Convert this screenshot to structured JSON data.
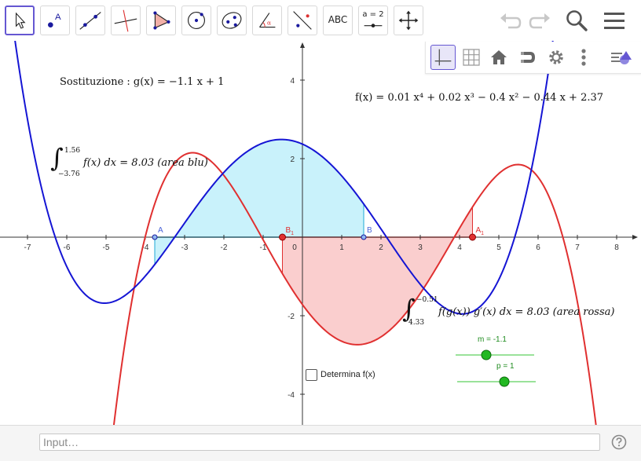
{
  "toolbar": {
    "tools": [
      {
        "name": "move-tool",
        "icon": "arrow-cursor-icon",
        "active": true
      },
      {
        "name": "point-tool",
        "icon": "point-a-icon"
      },
      {
        "name": "line-tool",
        "icon": "line-through-points-icon"
      },
      {
        "name": "perpendicular-tool",
        "icon": "perpendicular-line-icon"
      },
      {
        "name": "polygon-tool",
        "icon": "polygon-icon"
      },
      {
        "name": "circle-tool",
        "icon": "circle-center-icon"
      },
      {
        "name": "ellipse-tool",
        "icon": "ellipse-icon"
      },
      {
        "name": "angle-tool",
        "icon": "angle-icon"
      },
      {
        "name": "reflect-tool",
        "icon": "reflect-icon"
      },
      {
        "name": "text-tool",
        "icon": "text-icon",
        "label": "ABC"
      },
      {
        "name": "slider-tool",
        "icon": "slider-icon",
        "label": "a = 2"
      },
      {
        "name": "move-graphics-tool",
        "icon": "move-cross-icon"
      }
    ]
  },
  "graphics": {
    "substitution_label": "Sostituzione :  g(x) = −1.1 x + 1",
    "f_definition": "f(x) = 0.01 x⁴ + 0.02 x³ − 0.4 x² − 0.44 x + 2.37",
    "blue_integral": {
      "upper": "1.56",
      "lower": "−3.76",
      "body": "f(x) dx = 8.03  (area blu)"
    },
    "red_integral": {
      "upper": "−0.51",
      "lower": "4.33",
      "body": "f(g(x)) g′(x) dx = 8.03  (area rossa)"
    },
    "checkbox_label": "Determina f(x)",
    "checkbox_checked": false,
    "sliders": [
      {
        "label": "m = -1.1",
        "value": -1.1,
        "min": -5,
        "max": 5
      },
      {
        "label": "p = 1",
        "value": 1,
        "min": -5,
        "max": 5
      }
    ],
    "points": [
      {
        "name": "A",
        "x": -3.76,
        "y": 0
      },
      {
        "name": "B",
        "x": 1.56,
        "y": 0
      },
      {
        "name": "A",
        "subscript": "1",
        "x": 4.33,
        "y": 0
      },
      {
        "name": "B",
        "subscript": "1",
        "x": -0.51,
        "y": 0
      }
    ],
    "colors": {
      "blue_curve": "#1515d4",
      "red_curve": "#e03030",
      "blue_fill": "#bff0fa",
      "red_fill": "#f9c6c6",
      "slider": "#22b822"
    }
  },
  "chart_data": {
    "type": "line",
    "x_range": [
      -7,
      8
    ],
    "y_range": [
      -4,
      4
    ],
    "x_ticks": [
      "-7",
      "-6",
      "-5",
      "-4",
      "-3",
      "-2",
      "-1",
      "0",
      "1",
      "2",
      "3",
      "4",
      "5",
      "6",
      "7",
      "8"
    ],
    "y_ticks": [
      "4",
      "2",
      "-2",
      "-4"
    ],
    "series": [
      {
        "function": "f(x) = 0.01 x⁴ + 0.02 x³ − 0.4 x² − 0.44 x + 2.37",
        "color": "blue"
      },
      {
        "function": "f(g(x)) g′(x), g(x) = −1.1 x + 1",
        "color": "red"
      }
    ],
    "shaded_areas": [
      {
        "series": "blue",
        "from": -3.76,
        "to": 1.56,
        "area": 8.03
      },
      {
        "series": "red",
        "from": -0.51,
        "to": 4.33,
        "area": 8.03
      }
    ]
  },
  "inputbar": {
    "placeholder": "Input…"
  }
}
